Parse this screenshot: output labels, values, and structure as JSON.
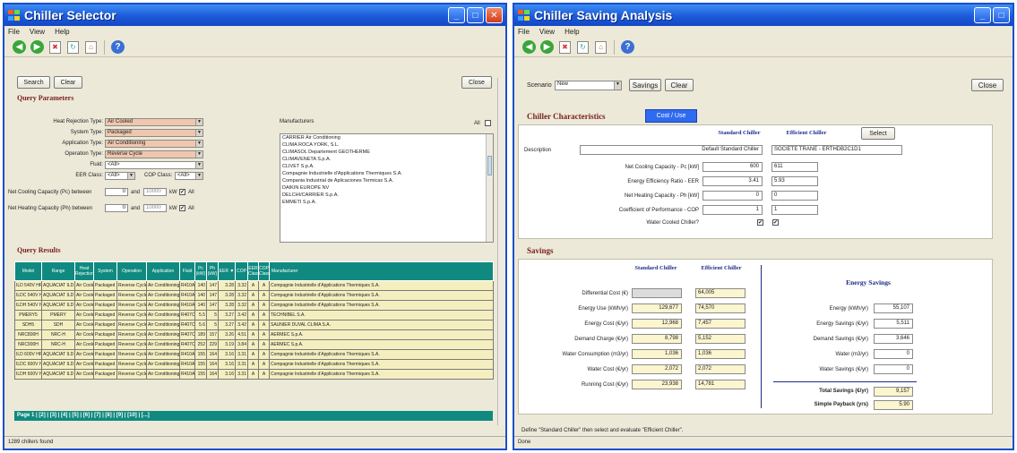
{
  "selector": {
    "title": "Chiller Selector",
    "menu": [
      "File",
      "View",
      "Help"
    ],
    "search_btn": "Search",
    "clear_btn": "Clear",
    "close_btn": "Close",
    "query_params_title": "Query Parameters",
    "heat_rejection_label": "Heat Rejection Type:",
    "heat_rejection_value": "Air Cooled",
    "system_type_label": "System Type:",
    "system_type_value": "Packaged",
    "application_label": "Application Type:",
    "application_value": "Air Conditioning",
    "operation_label": "Operation Type:",
    "operation_value": "Reverse Cycle",
    "fluid_label": "Fluid:",
    "fluid_value": "<All>",
    "eer_label": "EER Class:",
    "eer_value": "<All>",
    "cop_label": "COP Class:",
    "cop_value": "<All>",
    "cooling_label": "Net Cooling Capacity (Pc) between",
    "heating_label": "Net Heating Capacity (Ph) between",
    "cap_min": "0",
    "cap_and": "and",
    "cap_max": "10000",
    "cap_unit": "kW",
    "all_label": "All",
    "manufacturers_label": "Manufacturers",
    "manufacturers": [
      "CARRIER Air Conditioning",
      "CLIMA ROCA YORK, S.L.",
      "CLIMASOL Departement GEOTHERME",
      "CLIMAVENETA S.p.A.",
      "CLIVET S.p.A.",
      "Compagnie Industrielle d'Applications Thermiques S.A.",
      "Compania Industrial de Aplicaciones Termicas S.A.",
      "DAIKIN EUROPE NV",
      "DELCHI/CARRIER S.p.A.",
      "EMMETI S.p.A."
    ],
    "query_results_title": "Query Results",
    "columns": [
      "Model",
      "Range",
      "Heat Rejection",
      "System",
      "Operation",
      "Application",
      "Fluid",
      "Pc (kW)",
      "Ph (kW)",
      "EER ▼",
      "COP",
      "EER Class",
      "COP Class",
      "Manufacturer"
    ],
    "rows": [
      [
        "ILD 540V HP",
        "AQUACIAT ILD",
        "Air Cooled",
        "Packaged",
        "Reverse Cycle",
        "Air Conditioning",
        "R410A",
        "140",
        "147",
        "3.28",
        "3.32",
        "A",
        "A",
        "Compagnie Industrielle d'Applications Thermiques S.A."
      ],
      [
        "ILDC 540V HP",
        "AQUACIAT ILD",
        "Air Cooled",
        "Packaged",
        "Reverse Cycle",
        "Air Conditioning",
        "R410A",
        "140",
        "147",
        "3.28",
        "3.32",
        "A",
        "A",
        "Compagnie Industrielle d'Applications Thermiques S.A."
      ],
      [
        "ILDH 540V HP",
        "AQUACIAT ILD",
        "Air Cooled",
        "Packaged",
        "Reverse Cycle",
        "Air Conditioning",
        "R410A",
        "140",
        "147",
        "3.28",
        "3.32",
        "A",
        "A",
        "Compagnie Industrielle d'Applications Thermiques S.A."
      ],
      [
        "PMERY5",
        "PMERY",
        "Air Cooled",
        "Packaged",
        "Reverse Cycle",
        "Air Conditioning",
        "R407C",
        "5.5",
        "5",
        "3.27",
        "3.42",
        "A",
        "A",
        "TECHNIBEL S.A."
      ],
      [
        "SDH5",
        "SDH",
        "Air Cooled",
        "Packaged",
        "Reverse Cycle",
        "Air Conditioning",
        "R407C",
        "5.6",
        "5",
        "3.27",
        "3.42",
        "A",
        "A",
        "SAUNIER DUVAL CLIMA S.A."
      ],
      [
        "NRC800H",
        "NRC-H",
        "Air Cooled",
        "Packaged",
        "Reverse Cycle",
        "Air Conditioning",
        "R407C",
        "189",
        "157",
        "3.26",
        "4.51",
        "A",
        "A",
        "AERMEC S.p.A."
      ],
      [
        "NRC900H",
        "NRC-H",
        "Air Cooled",
        "Packaged",
        "Reverse Cycle",
        "Air Conditioning",
        "R407C",
        "252",
        "229",
        "3.19",
        "3.84",
        "A",
        "A",
        "AERMEC S.p.A."
      ],
      [
        "ILD 600V HP",
        "AQUACIAT ILD",
        "Air Cooled",
        "Packaged",
        "Reverse Cycle",
        "Air Conditioning",
        "R410A",
        "155",
        "164",
        "3.16",
        "3.31",
        "A",
        "A",
        "Compagnie Industrielle d'Applications Thermiques S.A."
      ],
      [
        "ILDC 600V HP",
        "AQUACIAT ILD",
        "Air Cooled",
        "Packaged",
        "Reverse Cycle",
        "Air Conditioning",
        "R410A",
        "155",
        "164",
        "3.16",
        "3.31",
        "A",
        "A",
        "Compagnie Industrielle d'Applications Thermiques S.A."
      ],
      [
        "ILDH 600V HP",
        "AQUACIAT ILD",
        "Air Cooled",
        "Packaged",
        "Reverse Cycle",
        "Air Conditioning",
        "R410A",
        "155",
        "164",
        "3.16",
        "3.31",
        "A",
        "A",
        "Compagnie Industrielle d'Applications Thermiques S.A."
      ]
    ],
    "pager": "Page 1 | [2] | [3] | [4] | [5] | [6] | [7] | [8] | [9] | [10] | [...]",
    "status": "1289 chillers found"
  },
  "saving": {
    "title": "Chiller Saving Analysis",
    "menu": [
      "File",
      "View",
      "Help"
    ],
    "scenario_label": "Scenario",
    "scenario_value": "New",
    "savings_btn": "Savings",
    "clear_btn": "Clear",
    "close_btn": "Close",
    "characteristics_title": "Chiller Characteristics",
    "cost_use_btn": "Cost / Use",
    "standard_chiller_hdr": "Standard Chiller",
    "efficient_chiller_hdr": "Efficient Chiller",
    "select_btn": "Select",
    "description_label": "Description",
    "description_std": "Default Standard Chiller",
    "description_eff": "SOCIETE TRANE - ERTHDB2C1D1",
    "char_rows": [
      {
        "label": "Net Cooling Capacity - Pc [kW]",
        "std": "600",
        "eff": "611"
      },
      {
        "label": "Energy Efficiency Ratio - EER",
        "std": "3.41",
        "eff": "5.93"
      },
      {
        "label": "Net Heating Capacity - Ph [kW]",
        "std": "0",
        "eff": "0"
      },
      {
        "label": "Coefficient of Performance - COP",
        "std": "1",
        "eff": "1"
      }
    ],
    "water_cooled_label": "Water Cooled Chiller?",
    "savings_title": "Savings",
    "sav_std_hdr": "Standard Chiller",
    "sav_eff_hdr": "Efficient Chiller",
    "cost_rows": [
      {
        "label": "Differential Cost (€)",
        "std": "",
        "eff": "64,005"
      },
      {
        "label": "Energy Use (kWh/yr)",
        "std": "129,677",
        "eff": "74,570"
      },
      {
        "label": "Energy Cost (€/yr)",
        "std": "12,968",
        "eff": "7,457"
      },
      {
        "label": "Demand Charge (€/yr)",
        "std": "8,798",
        "eff": "5,152"
      },
      {
        "label": "Water Consumption (m3/yr)",
        "std": "1,036",
        "eff": "1,036"
      },
      {
        "label": "Water Cost (€/yr)",
        "std": "2,072",
        "eff": "2,072"
      },
      {
        "label": "Running Cost (€/yr)",
        "std": "23,938",
        "eff": "14,781"
      }
    ],
    "energy_savings_hdr": "Energy Savings",
    "savings_rows": [
      {
        "label": "Energy (kWh/yr)",
        "value": "55,107"
      },
      {
        "label": "Energy Savings (€/yr)",
        "value": "5,511"
      },
      {
        "label": "Demand Savings (€/yr)",
        "value": "3,646"
      },
      {
        "label": "Water (m3/yr)",
        "value": "0"
      },
      {
        "label": "Water Savings (€/yr)",
        "value": "0"
      }
    ],
    "total_savings_label": "Total Savings (€/yr)",
    "total_savings_value": "9,157",
    "payback_label": "Simple Payback (yrs)",
    "payback_value": "5.90",
    "hint": "Define \"Standard Chiller\" then select and evaluate \"Efficient Chiller\".",
    "status": "Done"
  }
}
